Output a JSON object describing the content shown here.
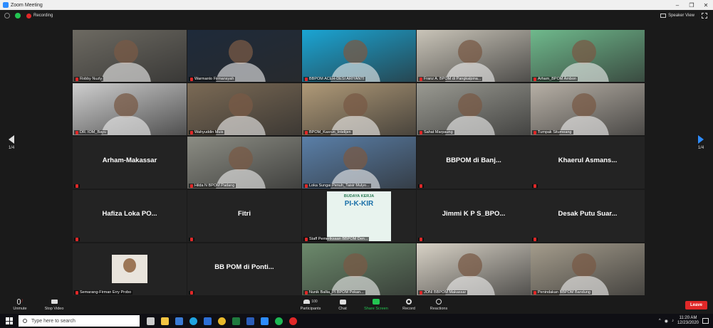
{
  "window": {
    "title": "Zoom Meeting"
  },
  "top_bar": {
    "recording_label": "Recording",
    "speaker_view_label": "Speaker View"
  },
  "pager": {
    "left_label": "1/4",
    "right_label": "1/4"
  },
  "tiles": [
    {
      "name": "Robby Nuzly",
      "kind": "video",
      "active": true,
      "bg": "#6d6a62"
    },
    {
      "name": "Warmanto Firmansyah",
      "kind": "video",
      "bg": "#1e2a3a"
    },
    {
      "name": "BBPOM ACEH-DESI ARIYANTI",
      "kind": "video",
      "bg": "#1aa5d4"
    },
    {
      "name": "Franz A. BPOM di Pangkalpina...",
      "kind": "video",
      "bg": "#c9c4b8"
    },
    {
      "name": "Arham_BPOM Ambon",
      "kind": "video",
      "bg": "#6fb98c"
    },
    {
      "name": "DR. IOM_Bayu",
      "kind": "video",
      "bg": "#cfcfcf"
    },
    {
      "name": "Wahyuddin Muis",
      "kind": "video",
      "bg": "#7b6a55"
    },
    {
      "name": "BPOM_Kasrun_Intelijen",
      "kind": "video",
      "bg": "#b09a78"
    },
    {
      "name": "Sahat Marpaung",
      "kind": "video",
      "bg": "#9a9a92"
    },
    {
      "name": "Tumpak Situmeang",
      "kind": "video",
      "bg": "#b7b0a6"
    },
    {
      "name": "Arham-Makassar",
      "kind": "name"
    },
    {
      "name": "Hilda N BPOM Padang",
      "kind": "video",
      "bg": "#8c8d84"
    },
    {
      "name": "Loka Sungai Penuh_Taisir Mulyo...",
      "kind": "video",
      "bg": "#5a7fa8"
    },
    {
      "name": "BBPOM di Banj...",
      "kind": "name"
    },
    {
      "name": "Khaerul Asmans...",
      "kind": "name"
    },
    {
      "name": "Hafiza Loka PO...",
      "kind": "name"
    },
    {
      "name": "Fitri",
      "kind": "name"
    },
    {
      "name": "Staff Pemeriksaan BBPOM Den...",
      "kind": "poster"
    },
    {
      "name": "Jimmi K P S_BPO...",
      "kind": "name"
    },
    {
      "name": "Desak Putu Suar...",
      "kind": "name"
    },
    {
      "name": "Semarang-Firman Erry Probo",
      "kind": "photo"
    },
    {
      "name": "BB POM di Ponti...",
      "kind": "name"
    },
    {
      "name": "Nunik Ballia_PI BPOM Pekan...",
      "kind": "video",
      "bg": "#6c8a6c"
    },
    {
      "name": "JONI BBPOM Makassar",
      "kind": "video",
      "bg": "#d8d2c6"
    },
    {
      "name": "Penindakan BBPOM Bandung",
      "kind": "video",
      "bg": "#a49c8c"
    }
  ],
  "poster": {
    "title": "BUDAYA KERJA",
    "subtitle": "PI-K-KIR"
  },
  "controls": {
    "unmute": "Unmute",
    "stop_video": "Stop Video",
    "participants": "Participants",
    "participants_count": "100",
    "chat": "Chat",
    "share_screen": "Share Screen",
    "record": "Record",
    "reactions": "Reactions",
    "leave": "Leave"
  },
  "colors": {
    "share_green": "#23c552",
    "leave_red": "#e02828",
    "zoom_blue": "#2d8cff"
  },
  "taskbar": {
    "search_placeholder": "Type here to search",
    "time": "11:20 AM",
    "date": "12/23/2020",
    "apps": [
      "task-view",
      "file-explorer",
      "store",
      "edge",
      "mail",
      "chrome",
      "excel",
      "word",
      "zoom",
      "spotify",
      "opera"
    ]
  }
}
